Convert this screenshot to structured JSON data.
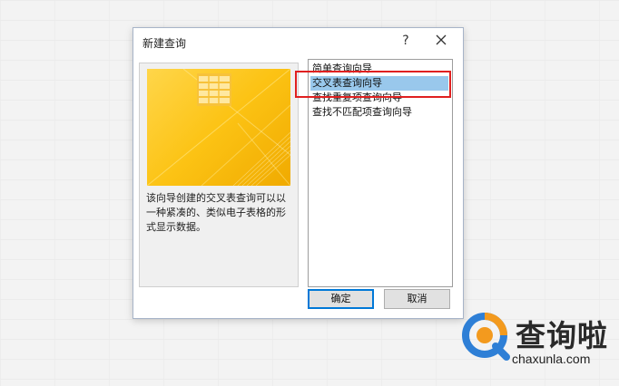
{
  "dialog": {
    "title": "新建查询",
    "help_label": "?",
    "description": "该向导创建的交叉表查询可以以一种紧凑的、类似电子表格的形式显示数据。",
    "list_items": [
      "简单查询向导",
      "交叉表查询向导",
      "查找重复项查询向导",
      "查找不匹配项查询向导"
    ],
    "selected_index": 1,
    "ok_label": "确定",
    "cancel_label": "取消"
  },
  "watermark": {
    "text": "查询啦",
    "url": "chaxunla.com"
  },
  "colors": {
    "accent_selection": "#99c8ec",
    "highlight_border": "#e02020",
    "preview_gold": "#fcc314"
  }
}
